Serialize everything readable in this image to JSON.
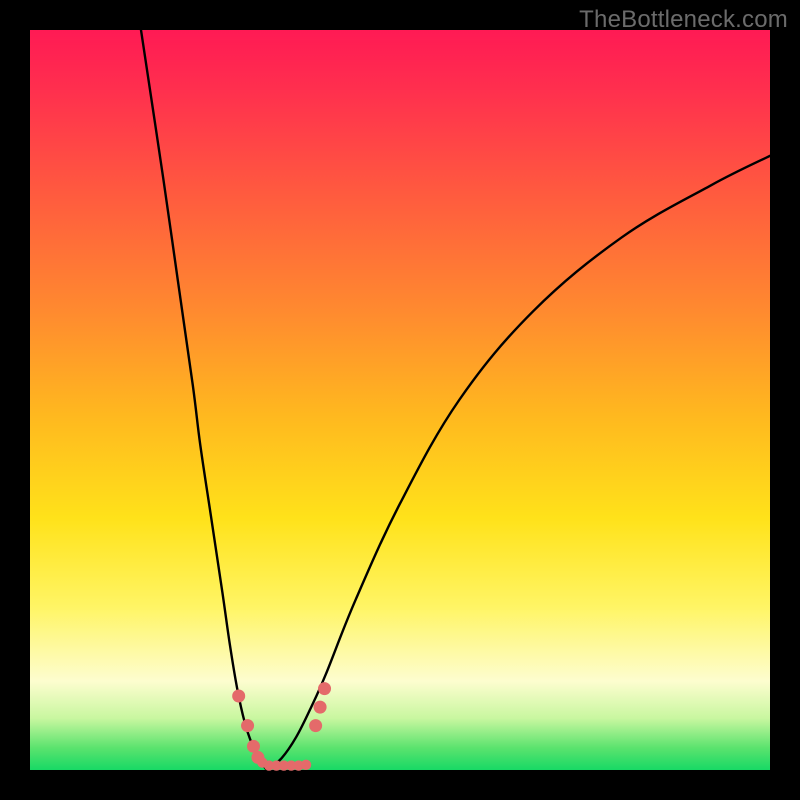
{
  "watermark": "TheBottleneck.com",
  "chart_data": {
    "type": "line",
    "title": "",
    "xlabel": "",
    "ylabel": "",
    "xlim": [
      0,
      100
    ],
    "ylim": [
      0,
      100
    ],
    "gradient_stops": [
      {
        "pct": 0,
        "color": "#ff1a54"
      },
      {
        "pct": 8,
        "color": "#ff2f4e"
      },
      {
        "pct": 22,
        "color": "#ff5a3f"
      },
      {
        "pct": 38,
        "color": "#ff8a2f"
      },
      {
        "pct": 52,
        "color": "#ffb81f"
      },
      {
        "pct": 66,
        "color": "#ffe21a"
      },
      {
        "pct": 78,
        "color": "#fff565"
      },
      {
        "pct": 88,
        "color": "#fdfdcf"
      },
      {
        "pct": 93,
        "color": "#c9f7a0"
      },
      {
        "pct": 97,
        "color": "#5be36e"
      },
      {
        "pct": 100,
        "color": "#17d965"
      }
    ],
    "series": [
      {
        "name": "bottleneck-curve-left",
        "x": [
          15,
          18,
          20,
          22,
          23,
          24.5,
          26,
          27,
          28,
          29,
          30,
          31,
          32
        ],
        "y": [
          100,
          80,
          66,
          52,
          44,
          34,
          24,
          17,
          11,
          6.5,
          3.5,
          1.4,
          0
        ]
      },
      {
        "name": "bottleneck-curve-right",
        "x": [
          32,
          34,
          36,
          38,
          40,
          44,
          50,
          58,
          68,
          80,
          92,
          100
        ],
        "y": [
          0,
          1.6,
          4.5,
          8.5,
          13,
          23,
          36,
          50,
          62,
          72,
          79,
          83
        ]
      }
    ],
    "markers": {
      "name": "highlight-points",
      "color": "#e46a6a",
      "points": [
        {
          "x": 28.2,
          "y": 10.0,
          "r": 5
        },
        {
          "x": 29.4,
          "y": 6.0,
          "r": 5
        },
        {
          "x": 30.2,
          "y": 3.2,
          "r": 5
        },
        {
          "x": 30.8,
          "y": 1.7,
          "r": 5
        },
        {
          "x": 31.4,
          "y": 1.0,
          "r": 4
        },
        {
          "x": 32.3,
          "y": 0.6,
          "r": 4
        },
        {
          "x": 33.3,
          "y": 0.6,
          "r": 4
        },
        {
          "x": 34.3,
          "y": 0.6,
          "r": 4
        },
        {
          "x": 35.3,
          "y": 0.6,
          "r": 4
        },
        {
          "x": 36.3,
          "y": 0.6,
          "r": 4
        },
        {
          "x": 37.3,
          "y": 0.7,
          "r": 4
        },
        {
          "x": 38.6,
          "y": 6.0,
          "r": 5
        },
        {
          "x": 39.2,
          "y": 8.5,
          "r": 5
        },
        {
          "x": 39.8,
          "y": 11.0,
          "r": 5
        }
      ]
    }
  }
}
